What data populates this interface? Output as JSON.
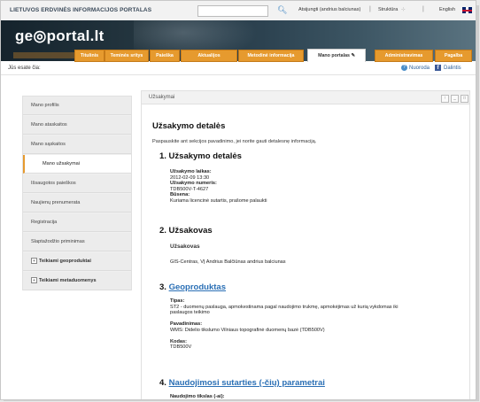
{
  "topbar": {
    "site_title": "LIETUVOS ERDVINĖS INFORMACIJOS PORTALAS",
    "logged_in": "Atsijungti (andrius balciunas)",
    "structure": "Struktūra",
    "lang": "English"
  },
  "header": {
    "logo": "ge◎portal.lt"
  },
  "nav": [
    {
      "label": "Titulinis"
    },
    {
      "label": "Teminės sritys"
    },
    {
      "label": "Paieška"
    },
    {
      "label": "Aktualijos"
    },
    {
      "label": "Metodinė informacija"
    },
    {
      "label": "Mano portalas"
    },
    {
      "label": "Administravimas"
    },
    {
      "label": "Pagalba"
    }
  ],
  "breadcrumb": {
    "label": "Jūs esate čia:",
    "help": "Nuoroda",
    "share": "Dalintis"
  },
  "sidebar": {
    "items": [
      {
        "label": "Mano profilis"
      },
      {
        "label": "Mano ataskaitos"
      },
      {
        "label": "Mano sąskaitos"
      },
      {
        "label": "Mano užsakymai"
      },
      {
        "label": "Išsaugotos paieškos"
      },
      {
        "label": "Naujienų prenumerata"
      },
      {
        "label": "Registracija"
      },
      {
        "label": "Slaptažodžio priminimas"
      },
      {
        "label": "Teikiami geoproduktai"
      },
      {
        "label": "Teikiami metaduomenys"
      }
    ]
  },
  "panel": {
    "title": "Užsakymai",
    "heading": "Užsakymo detalės",
    "intro": "Paspauskite ant sekcijos pavadinimo, jei norite gauti detalesnę informaciją.",
    "s1": {
      "title": "1. Užsakymo detalės",
      "time_label": "Užsakymo laikas:",
      "time_value": "2012-02-09 13:30",
      "num_label": "Užsakymo numeris:",
      "num_value": "TDB500V-T-4627",
      "status_label": "Būsena:",
      "status_value": "Kuriama licencinė sutartis, prašome palaukti"
    },
    "s2": {
      "title": "2. Užsakovas",
      "sub": "Užsakovas",
      "value": "GIS-Centras, VĮ Andrius Balčiūnas andrius balciunas"
    },
    "s3": {
      "num": "3.",
      "title": "Geoproduktas",
      "type_label": "Tipas:",
      "type_value_1": "ST2 - duomenų paslauga, apmokestinama pagal naudojimo trukmę, apmokėjimas už kurią vykdomas iki",
      "type_value_2": "paslaugos teikimo",
      "name_label": "Pavadinimas:",
      "name_value": "WMS: Didelio tikslumo Vilniaus topografinė duomenų bazė (TDB500V)",
      "code_label": "Kodas:",
      "code_value": "TDB500V"
    },
    "s4": {
      "num": "4.",
      "title": "Naudojimosi sutarties (-čių) parametrai",
      "purpose_label": "Naudojimo tikslas (-ai):"
    }
  }
}
